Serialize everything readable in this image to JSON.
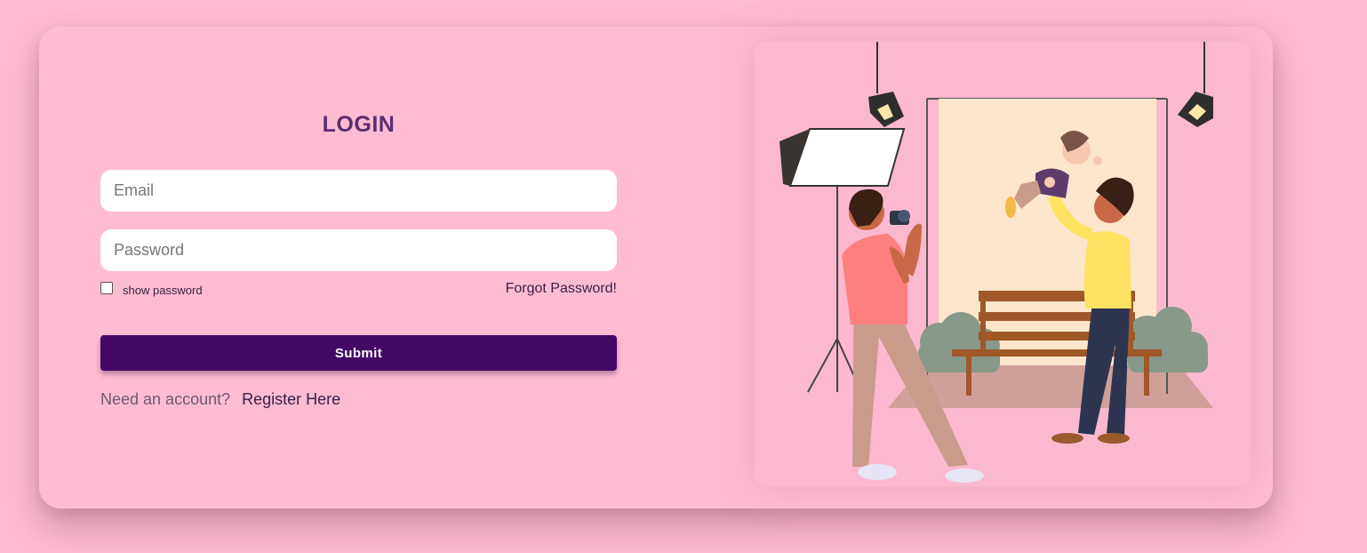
{
  "login": {
    "title": "LOGIN",
    "email_placeholder": "Email",
    "password_placeholder": "Password",
    "show_password_label": "show password",
    "forgot_password_label": "Forgot Password!",
    "submit_label": "Submit",
    "register_prompt": "Need an account?",
    "register_link_label": "Register Here"
  },
  "illustration": {
    "semantic": "photographer-family-photoshoot-illustration"
  },
  "colors": {
    "background": "#fdbcd2",
    "title": "#5a2d6e",
    "submit_button": "#430866",
    "link": "#3a1f4a",
    "backdrop": "#fde6cc",
    "bench": "#a0582a",
    "shrub": "#879988",
    "floor": "#cfa09a"
  }
}
